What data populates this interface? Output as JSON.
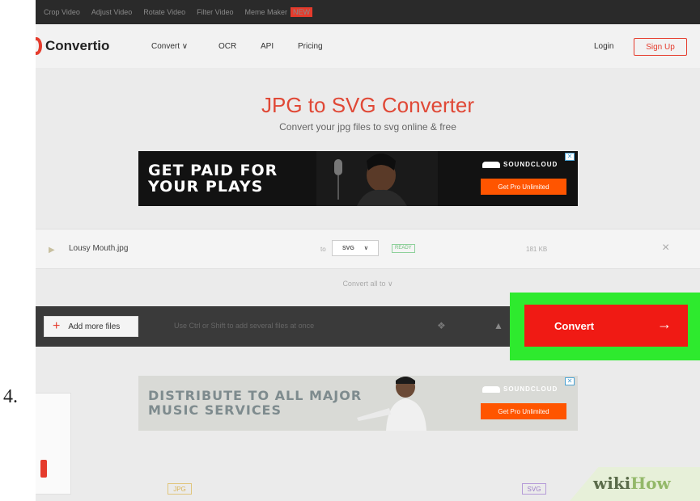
{
  "step_number": "4.",
  "topbar": {
    "links": [
      "Crop Video",
      "Adjust Video",
      "Rotate Video",
      "Filter Video"
    ],
    "meme_maker": "Meme Maker",
    "new_badge": "NEW"
  },
  "nav": {
    "logo": "Convertio",
    "convert": "Convert ∨",
    "ocr": "OCR",
    "api": "API",
    "pricing": "Pricing",
    "login": "Login",
    "signup": "Sign Up"
  },
  "hero": {
    "title": "JPG to SVG Converter",
    "subtitle": "Convert your jpg files to svg online & free"
  },
  "ad_top": {
    "line1": "GET PAID FOR",
    "line2": "YOUR PLAYS",
    "brand": "SOUNDCLOUD",
    "cta": "Get Pro Unlimited"
  },
  "file": {
    "name": "Lousy Mouth.jpg",
    "to_label": "to",
    "format": "SVG",
    "status": "READY",
    "size": "181 KB",
    "remove": "×"
  },
  "convert_all": "Convert all to ∨",
  "toolbar": {
    "add_files": "Add more files",
    "hint": "Use Ctrl or Shift to add several files at once",
    "convert": "Convert",
    "arrow": "→"
  },
  "ad_bottom": {
    "line1": "DISTRIBUTE TO ALL MAJOR",
    "line2": "MUSIC SERVICES",
    "brand": "SOUNDCLOUD",
    "cta": "Get Pro Unlimited"
  },
  "format_tags": {
    "from": "JPG",
    "to": "SVG"
  },
  "watermark": {
    "part1": "wiki",
    "part2": "How"
  },
  "colors": {
    "accent": "#e53b2c",
    "highlight": "#2eea2e",
    "convert": "#f01a14"
  }
}
